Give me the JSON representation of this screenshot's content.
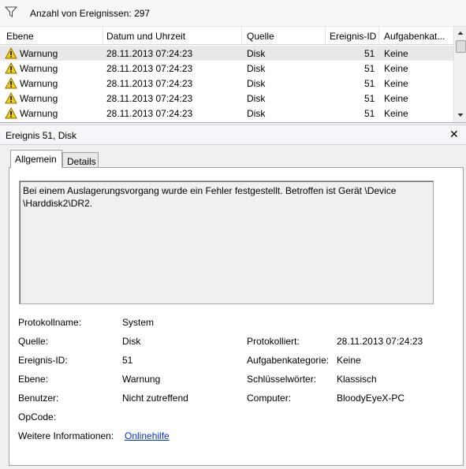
{
  "filter_bar": {
    "icon": "filter-icon",
    "text": "Anzahl von Ereignissen: 297"
  },
  "event_list": {
    "columns": [
      "Ebene",
      "Datum und Uhrzeit",
      "Quelle",
      "Ereignis-ID",
      "Aufgabenkat..."
    ],
    "rows": [
      {
        "level": "Warnung",
        "datetime": "28.11.2013 07:24:23",
        "source": "Disk",
        "event_id": "51",
        "task": "Keine"
      },
      {
        "level": "Warnung",
        "datetime": "28.11.2013 07:24:23",
        "source": "Disk",
        "event_id": "51",
        "task": "Keine"
      },
      {
        "level": "Warnung",
        "datetime": "28.11.2013 07:24:23",
        "source": "Disk",
        "event_id": "51",
        "task": "Keine"
      },
      {
        "level": "Warnung",
        "datetime": "28.11.2013 07:24:23",
        "source": "Disk",
        "event_id": "51",
        "task": "Keine"
      },
      {
        "level": "Warnung",
        "datetime": "28.11.2013 07:24:23",
        "source": "Disk",
        "event_id": "51",
        "task": "Keine"
      }
    ]
  },
  "detail": {
    "title": "Ereignis 51, Disk",
    "close": "✕",
    "tabs": [
      "Allgemein",
      "Details"
    ],
    "description": "Bei einem Auslagerungsvorgang wurde ein Fehler festgestellt. Betroffen ist Gerät \\Device \\Harddisk2\\DR2.",
    "fields": {
      "protokollname_label": "Protokollname:",
      "protokollname_value": "System",
      "quelle_label": "Quelle:",
      "quelle_value": "Disk",
      "protokolliert_label": "Protokolliert:",
      "protokolliert_value": "28.11.2013 07:24:23",
      "ereignis_id_label": "Ereignis-ID:",
      "ereignis_id_value": "51",
      "aufgabenkategorie_label": "Aufgabenkategorie:",
      "aufgabenkategorie_value": "Keine",
      "ebene_label": "Ebene:",
      "ebene_value": "Warnung",
      "schluesselwoerter_label": "Schlüsselwörter:",
      "schluesselwoerter_value": "Klassisch",
      "benutzer_label": "Benutzer:",
      "benutzer_value": "Nicht zutreffend",
      "computer_label": "Computer:",
      "computer_value": "BloodyEyeX-PC",
      "opcode_label": "OpCode:",
      "opcode_value": "",
      "weitere_label": "Weitere Informationen:",
      "weitere_link": "Onlinehilfe"
    }
  },
  "colors": {
    "link": "#0033cc",
    "selected_row": "#e8e8e8",
    "warning_yellow": "#f5d000"
  }
}
